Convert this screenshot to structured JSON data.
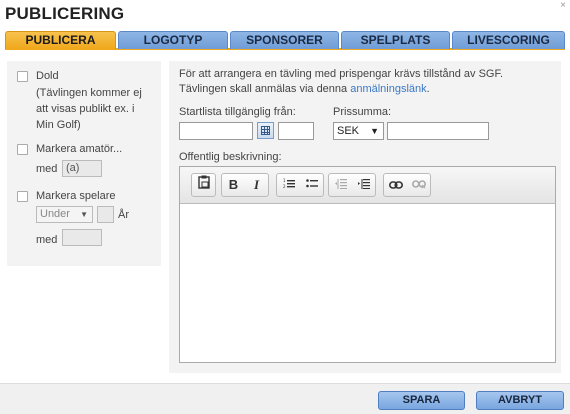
{
  "dialog": {
    "title": "PUBLICERING",
    "close_glyph": "×"
  },
  "tabs": [
    {
      "label": "PUBLICERA",
      "active": true
    },
    {
      "label": "LOGOTYP",
      "active": false
    },
    {
      "label": "SPONSORER",
      "active": false
    },
    {
      "label": "SPELPLATS",
      "active": false
    },
    {
      "label": "LIVESCORING",
      "active": false
    }
  ],
  "left": {
    "dold_label": "Dold",
    "dold_note": [
      "(Tävlingen kommer ej",
      "att visas publikt ex. i",
      "Min Golf)"
    ],
    "amator_label": "Markera amatör...",
    "amator_with_label": "med",
    "amator_value": "(a)",
    "spelare_label": "Markera spelare",
    "age_select_value": "Under",
    "age_unit": "År",
    "spelare_with_label": "med",
    "spelare_value": ""
  },
  "main": {
    "info_line1": "För att arrangera en tävling med prispengar krävs tillstånd av SGF.",
    "info_line2_prefix": "Tävlingen skall anmälas via denna ",
    "info_link": "anmälningslänk",
    "info_line2_suffix": ".",
    "startlista_label": "Startlista tillgänglig från:",
    "date_value": "",
    "time_value": "",
    "prissumma_label": "Prissumma:",
    "currency_value": "SEK",
    "amount_value": "",
    "description_label": "Offentlig beskrivning:",
    "description_value": ""
  },
  "toolbar": {
    "icons": [
      "paste-icon",
      "bold-icon",
      "italic-icon",
      "numbered-list-icon",
      "bullet-list-icon",
      "outdent-icon",
      "indent-icon",
      "link-icon",
      "unlink-icon"
    ],
    "bold_glyph": "B",
    "italic_glyph": "I"
  },
  "footer": {
    "save_label": "SPARA",
    "cancel_label": "AVBRYT"
  },
  "colors": {
    "active_tab": "#f0a81c",
    "tab": "#7aa6dd",
    "button": "#8bb4e6",
    "link": "#3a78c4"
  }
}
